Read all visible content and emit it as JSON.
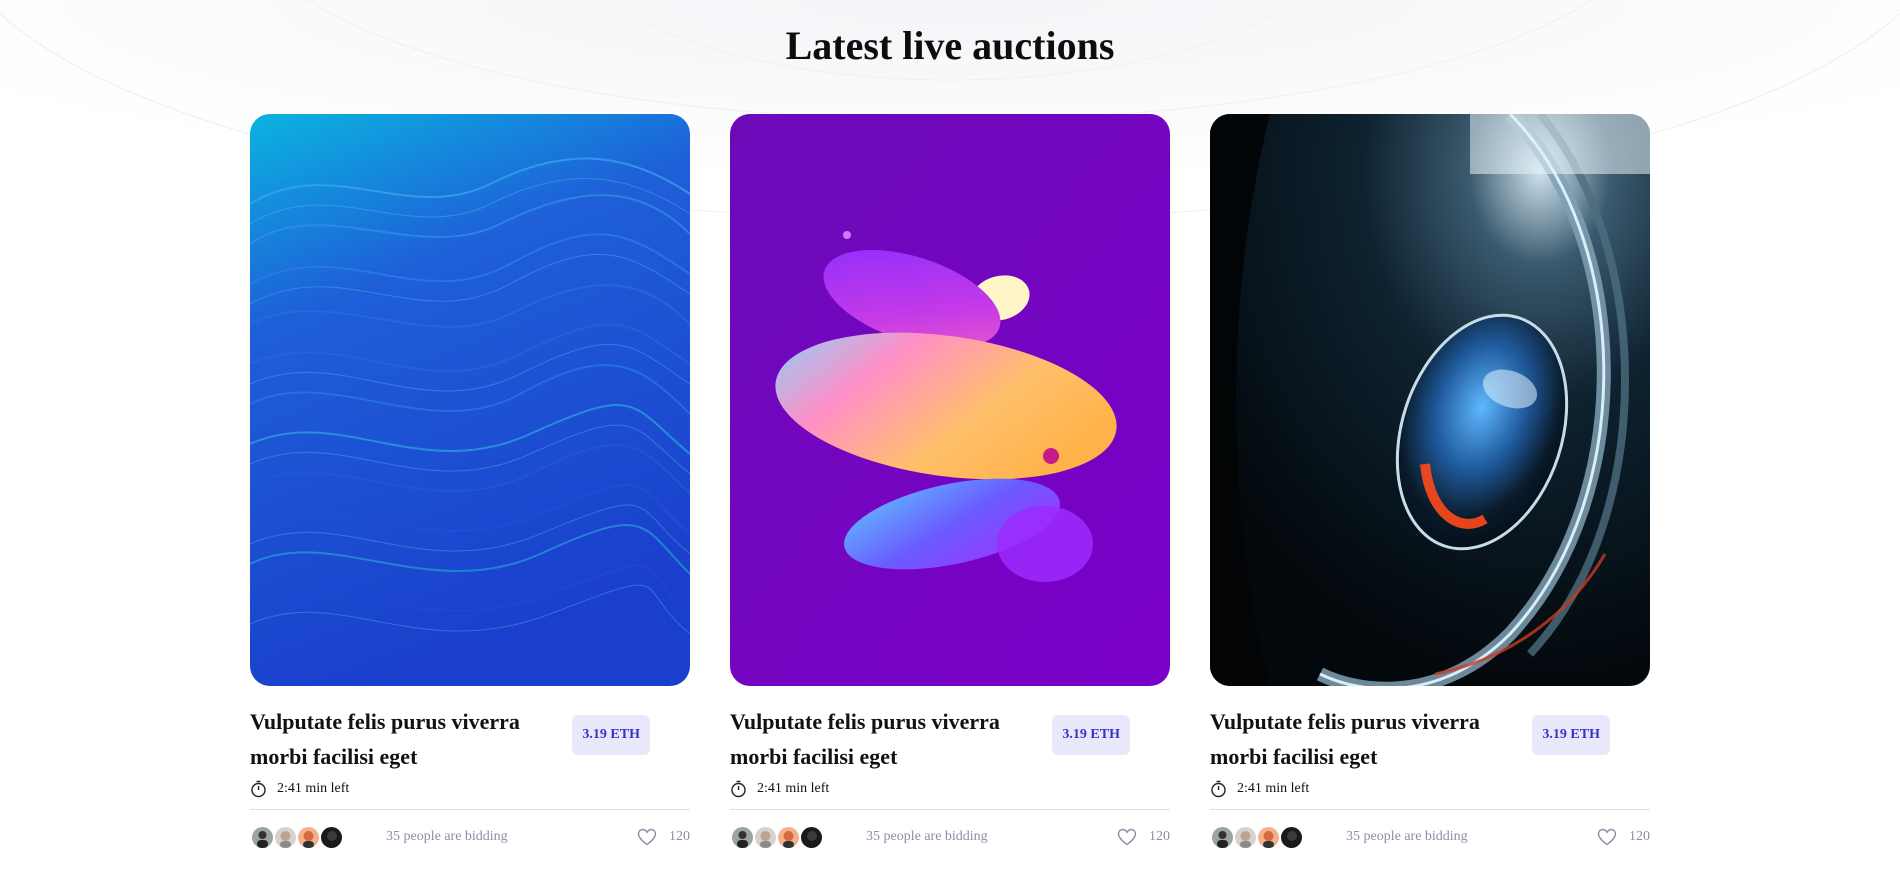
{
  "section": {
    "title": "Latest live auctions"
  },
  "colors": {
    "accent": "#3a32c9",
    "price_bg": "#e9e8fb",
    "muted": "#8a8fa3"
  },
  "cards": [
    {
      "artwork": "blue-waves",
      "title": "Vulputate felis purus viverra morbi facilisi eget",
      "price": "3.19 ETH",
      "time_left": "2:41 min left",
      "bidders_text": "35 people are bidding",
      "likes": "120",
      "icons": [
        "stopwatch-icon",
        "heart-icon"
      ]
    },
    {
      "artwork": "purple-discs",
      "title": "Vulputate felis purus viverra morbi facilisi eget",
      "price": "3.19 ETH",
      "time_left": "2:41 min left",
      "bidders_text": "35 people are bidding",
      "likes": "120",
      "icons": [
        "stopwatch-icon",
        "heart-icon"
      ]
    },
    {
      "artwork": "glass-sphere",
      "title": "Vulputate felis purus viverra morbi facilisi eget",
      "price": "3.19 ETH",
      "time_left": "2:41 min left",
      "bidders_text": "35 people are bidding",
      "likes": "120",
      "icons": [
        "stopwatch-icon",
        "heart-icon"
      ]
    }
  ]
}
